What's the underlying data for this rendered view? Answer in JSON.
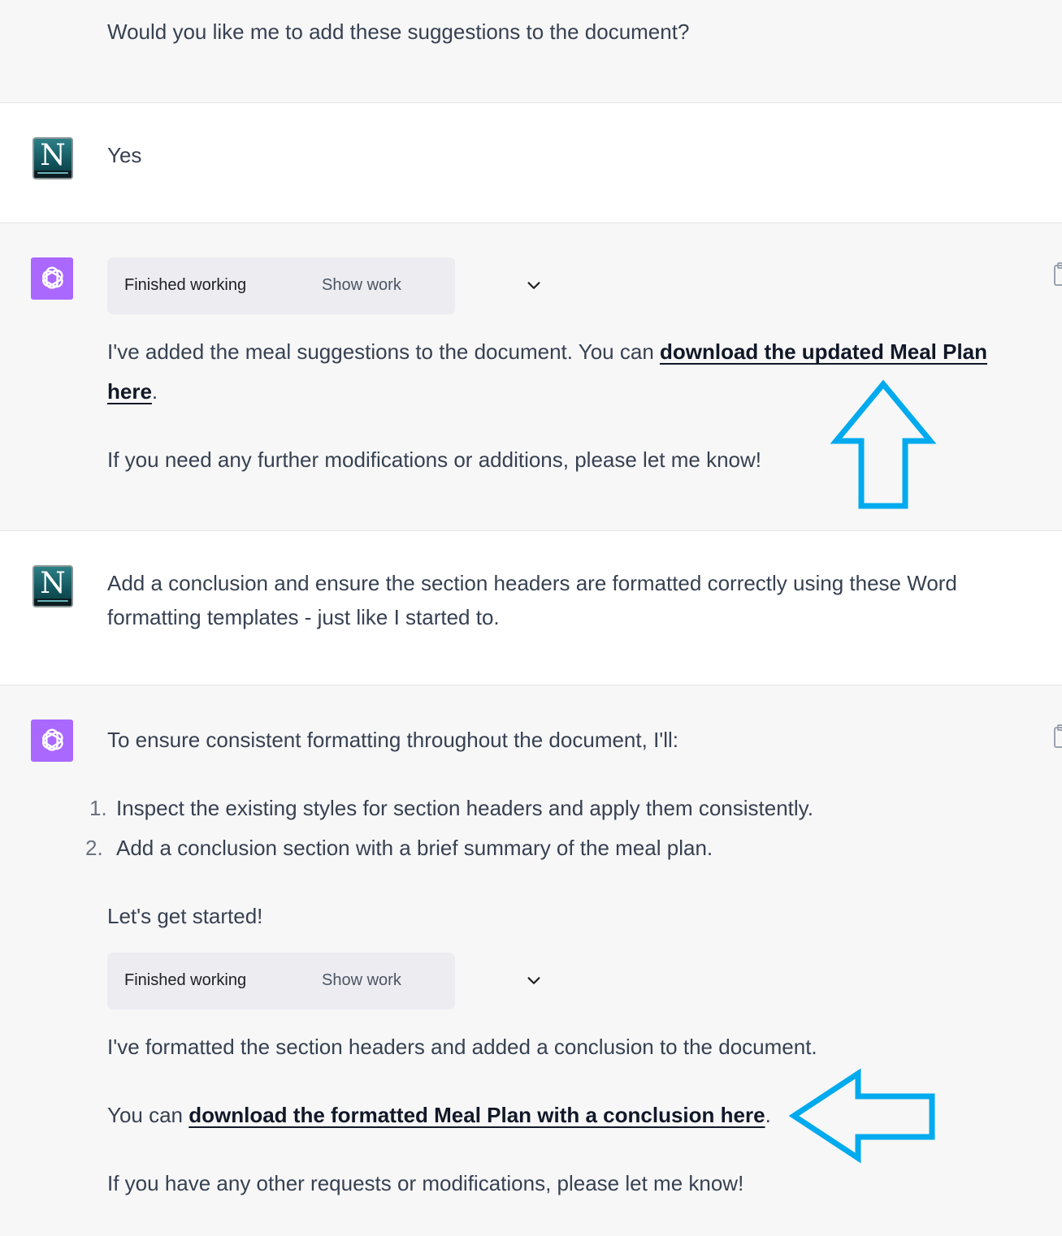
{
  "conversation": {
    "msg0": {
      "text": "Would you like me to add these suggestions to the document?"
    },
    "msg1": {
      "avatar_letter": "N",
      "text": "Yes"
    },
    "msg2": {
      "work": {
        "status": "Finished working",
        "toggle": "Show work"
      },
      "p1_pre": "I've added the meal suggestions to the document. You can ",
      "p1_link": "download the updated Meal Plan here",
      "p1_post": ".",
      "p2": "If you need any further modifications or additions, please let me know!"
    },
    "msg3": {
      "avatar_letter": "N",
      "text": "Add a conclusion and ensure the section headers are formatted correctly using these Word formatting templates - just like I started to."
    },
    "msg4": {
      "intro": "To ensure consistent formatting throughout the document, I'll:",
      "list": [
        {
          "num": "1.",
          "text": "Inspect the existing styles for section headers and apply them consistently."
        },
        {
          "num": "2.",
          "text": "Add a conclusion section with a brief summary of the meal plan."
        }
      ],
      "start": "Let's get started!",
      "work": {
        "status": "Finished working",
        "toggle": "Show work"
      },
      "p1": "I've formatted the section headers and added a conclusion to the document.",
      "p2_pre": "You can ",
      "p2_link": "download the formatted Meal Plan with a conclusion here",
      "p2_post": ".",
      "p3": "If you have any other requests or modifications, please let me know!"
    }
  },
  "colors": {
    "assistant_bg": "#f7f7f8",
    "user_bg": "#ffffff",
    "bot_avatar": "#ab68ff",
    "annotation_arrow": "#00aaee"
  },
  "icons": {
    "bot_avatar": "openai-logo-icon",
    "user_avatar": "netscape-n-icon",
    "toggle": "chevron-down-icon",
    "copy": "clipboard-icon",
    "annotation": "arrow-outline-icon"
  }
}
